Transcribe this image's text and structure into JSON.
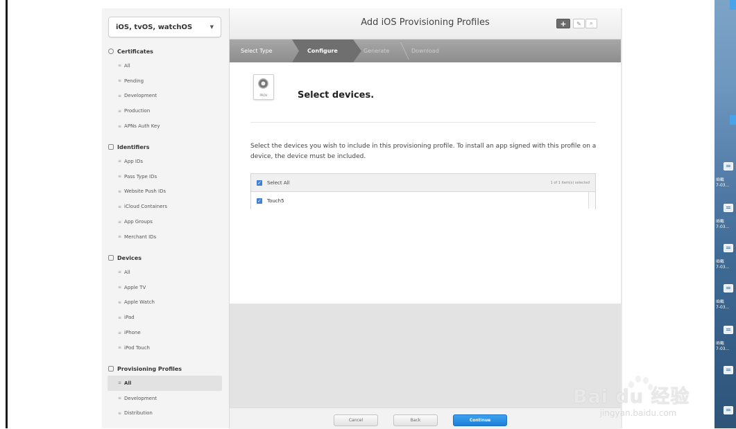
{
  "platform_selector": {
    "label": "iOS, tvOS, watchOS"
  },
  "sidebar": {
    "sections": [
      {
        "title": "Certificates",
        "items": [
          "All",
          "Pending",
          "Development",
          "Production",
          "APNs Auth Key"
        ]
      },
      {
        "title": "Identifiers",
        "items": [
          "App IDs",
          "Pass Type IDs",
          "Website Push IDs",
          "iCloud Containers",
          "App Groups",
          "Merchant IDs"
        ]
      },
      {
        "title": "Devices",
        "items": [
          "All",
          "Apple TV",
          "Apple Watch",
          "iPad",
          "iPhone",
          "iPod Touch"
        ]
      },
      {
        "title": "Provisioning Profiles",
        "items": [
          "All",
          "Development",
          "Distribution"
        ],
        "active": "All"
      }
    ]
  },
  "header": {
    "title": "Add iOS Provisioning Profiles"
  },
  "steps": [
    "Select Type",
    "Configure",
    "Generate",
    "Download"
  ],
  "current_step": "Configure",
  "content": {
    "icon_label": "PROV",
    "heading": "Select devices.",
    "description": "Select the devices you wish to include in this provisioning profile. To install an app signed with this profile on a device, the device must be included.",
    "select_all_label": "Select All",
    "selection_count": "1 of 1 item(s) selected",
    "devices": [
      {
        "name": "Touch5",
        "checked": true
      }
    ]
  },
  "footer": {
    "cancel": "Cancel",
    "back": "Back",
    "continue": "Continue"
  },
  "watermark": {
    "brand": "Bai du 经验",
    "url": "jingyan.baidu.com"
  },
  "desktop": {
    "labels": [
      "IB截",
      "7-03...",
      "IB截",
      "7-03...",
      "IB截",
      "7-03...",
      "IB截",
      "7-03...",
      "IB截",
      "7-03..."
    ]
  },
  "colors": {
    "accent": "#1d7fd8",
    "checkbox": "#3d82d8",
    "step_bar": "#9a9a9a"
  }
}
